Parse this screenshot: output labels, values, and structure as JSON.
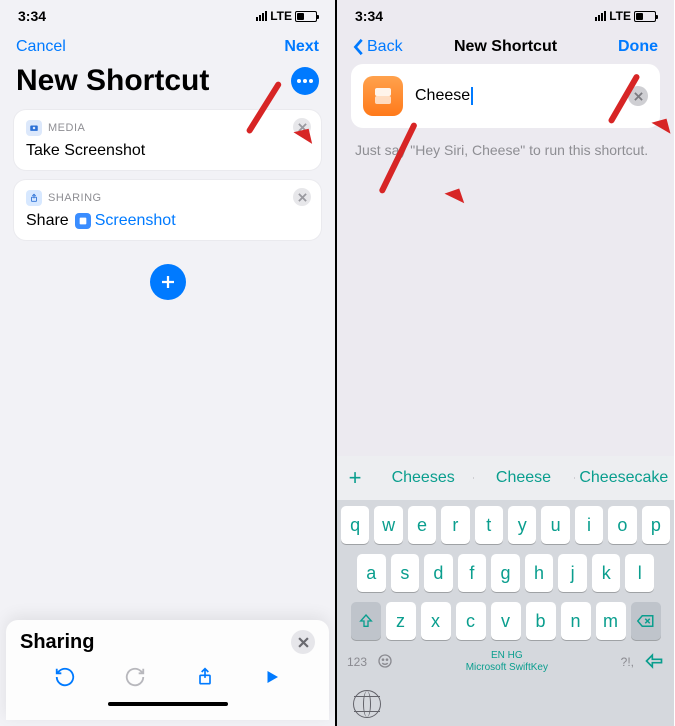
{
  "status": {
    "time": "3:34",
    "network": "LTE"
  },
  "left": {
    "nav": {
      "cancel": "Cancel",
      "next": "Next"
    },
    "title": "New Shortcut",
    "cards": {
      "media": {
        "category": "MEDIA",
        "label": "Take Screenshot"
      },
      "sharing": {
        "category": "SHARING",
        "label": "Share",
        "token_label": "Screenshot"
      }
    },
    "panel": {
      "title": "Sharing"
    }
  },
  "right": {
    "nav": {
      "back": "Back",
      "title": "New Shortcut",
      "done": "Done"
    },
    "shortcut_name": "Cheese",
    "hint": "Just say \"Hey Siri, Cheese\" to run this shortcut.",
    "suggestions": {
      "plus": "+",
      "items": [
        "Cheeses",
        "Cheese",
        "Cheesecake"
      ]
    },
    "keyboard": {
      "row1": [
        "q",
        "w",
        "e",
        "r",
        "t",
        "y",
        "u",
        "i",
        "o",
        "p"
      ],
      "row2": [
        "a",
        "s",
        "d",
        "f",
        "g",
        "h",
        "j",
        "k",
        "l"
      ],
      "row3": [
        "z",
        "x",
        "c",
        "v",
        "b",
        "n",
        "m"
      ],
      "fn": {
        "num": "123",
        "lang": "EN HG",
        "brand": "Microsoft SwiftKey",
        "punct": "?!,"
      }
    }
  }
}
